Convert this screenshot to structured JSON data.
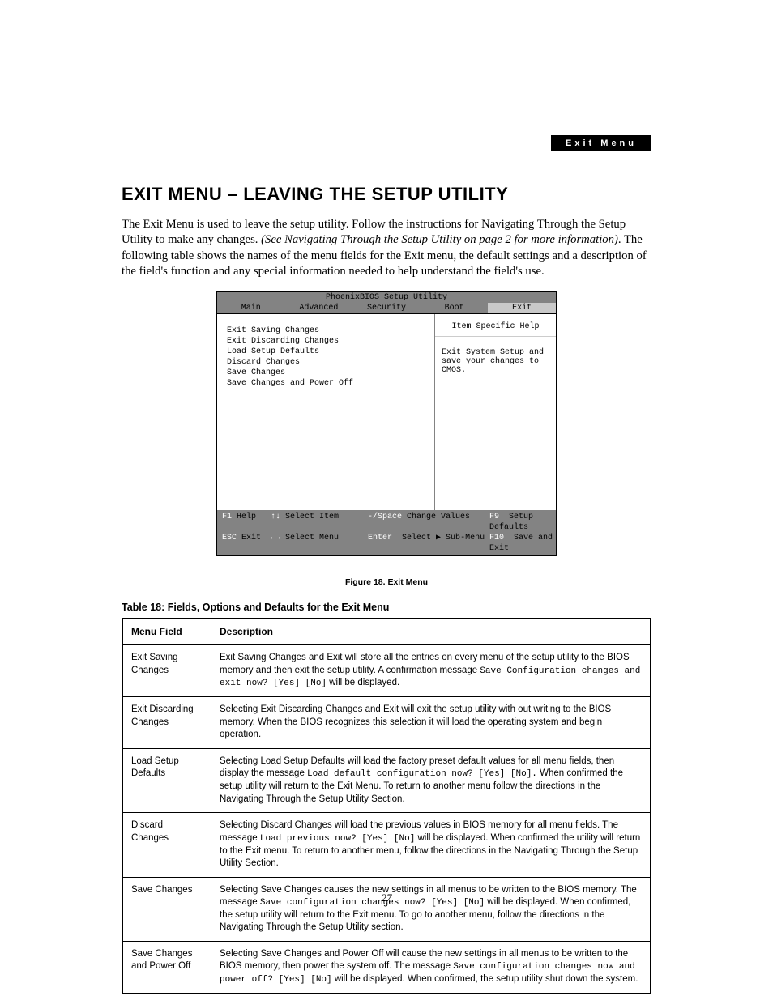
{
  "header_label": "Exit Menu",
  "h1": "EXIT MENU – LEAVING THE SETUP UTILITY",
  "intro": {
    "a": "The Exit Menu is used to leave the setup utility. Follow the instructions for Navigating Through the Setup Utility to make any changes. ",
    "b": "(See Navigating Through the Setup Utility on page 2 for more information)",
    "c": ". The following table shows the names of the menu fields for the Exit menu, the default settings and a description of the field's function and any special information needed to help understand the field's use."
  },
  "bios": {
    "title": "PhoenixBIOS Setup Utility",
    "tabs": [
      "Main",
      "Advanced",
      "Security",
      "Boot",
      "Exit"
    ],
    "active_tab": 4,
    "options": [
      "Exit Saving Changes",
      "Exit Discarding Changes",
      "Load Setup Defaults",
      "Discard Changes",
      "Save Changes",
      "Save Changes and Power Off"
    ],
    "help_title": "Item Specific Help",
    "help_text": "Exit System Setup and save your changes to CMOS.",
    "footer": {
      "f1k": "F1",
      "f1": "Help",
      "sel_item_k": "↑↓",
      "sel_item": "Select Item",
      "chg_k": "-/Space",
      "chg": "Change Values",
      "f9k": "F9",
      "f9": "Setup Defaults",
      "esck": "ESC",
      "esc": "Exit",
      "sel_menu_k": "←→",
      "sel_menu": "Select Menu",
      "enterk": "Enter",
      "enter": "Select ▶ Sub-Menu",
      "f10k": "F10",
      "f10": "Save and Exit"
    }
  },
  "figure_caption": "Figure 18.   Exit Menu",
  "table_caption": "Table 18: Fields, Options and Defaults for the Exit Menu",
  "table_headers": [
    "Menu Field",
    "Description"
  ],
  "rows": [
    {
      "field": "Exit Saving Changes",
      "desc_a": "Exit Saving Changes and Exit will store all the entries on every menu of the setup utility to the BIOS memory and then exit the setup utility. A confirmation message ",
      "code": "Save Configuration changes and exit now? [Yes] [No]",
      "desc_b": " will be displayed."
    },
    {
      "field": "Exit Discarding Changes",
      "desc_a": "Selecting Exit Discarding Changes and Exit will exit the setup utility with out writing to the BIOS memory. When the BIOS recognizes this selection it will load the operating system and begin operation.",
      "code": "",
      "desc_b": ""
    },
    {
      "field": "Load Setup Defaults",
      "desc_a": "Selecting Load Setup Defaults will load the factory preset default values for all menu fields, then display the message ",
      "code": "Load default configuration now? [Yes] [No].",
      "desc_b": " When confirmed the setup utility will return to the Exit Menu. To return to another menu follow the directions in the Navigating Through the Setup Utility Section."
    },
    {
      "field": "Discard Changes",
      "desc_a": "Selecting Discard Changes will load the previous values in BIOS memory for all menu fields. The message ",
      "code": "Load previous now? [Yes] [No]",
      "desc_b": " will be displayed. When confirmed the  utility will return to the Exit menu. To return to another menu, follow the directions in the Navigating Through the Setup Utility Section."
    },
    {
      "field": "Save Changes",
      "desc_a": "Selecting Save Changes causes the new settings in all menus to be written to the BIOS memory. The message ",
      "code": "Save configuration changes now? [Yes] [No]",
      "desc_b": " will be displayed. When confirmed, the setup utility will return to the Exit menu. To go to another menu, follow the directions in the Navigating Through the Setup Utility section."
    },
    {
      "field": "Save Changes and Power Off",
      "desc_a": "Selecting Save Changes and Power Off will cause the new settings in all menus to be written to the BIOS memory, then power the system off. The message ",
      "code": "Save configuration changes now and power off? [Yes] [No]",
      "desc_b": " will be displayed. When confirmed, the setup utility shut down the system."
    }
  ],
  "page_number": "27"
}
